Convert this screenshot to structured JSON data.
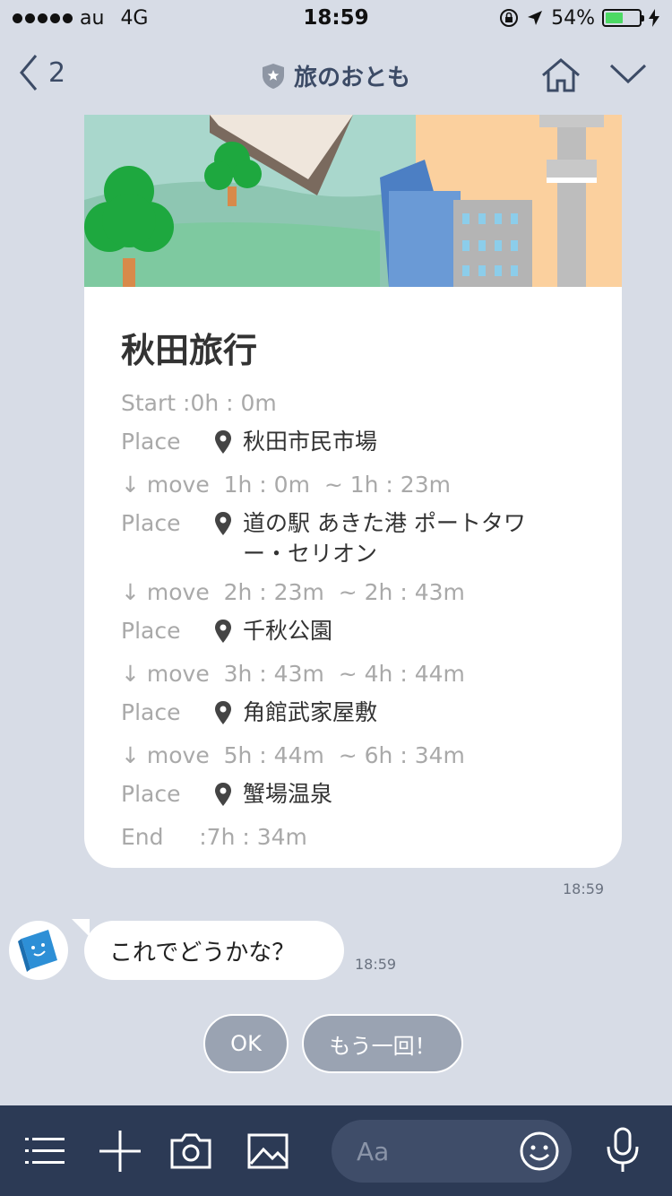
{
  "status_bar": {
    "carrier": "au",
    "network": "4G",
    "time": "18:59",
    "battery": "54%",
    "battery_level": 0.54
  },
  "nav": {
    "back_count": "2",
    "title": "旅のおとも"
  },
  "card": {
    "title": "秋田旅行",
    "start": {
      "label": "Start",
      "value": " :0h : 0m"
    },
    "end": {
      "label": "End",
      "value": "     :7h : 34m"
    },
    "place_label": "Place",
    "move_label": "↓ move",
    "places": [
      "秋田市民市場",
      "道の駅 あきた港 ポートタワー・セリオン",
      "千秋公園",
      "角館武家屋敷",
      "蟹場温泉"
    ],
    "moves": [
      "  1h : 0m  ~ 1h : 23m",
      "  2h : 23m  ~ 2h : 43m",
      "  3h : 43m  ~ 4h : 44m",
      "  5h : 44m  ~ 6h : 34m"
    ],
    "timestamp": "18:59"
  },
  "bot_message": {
    "text": "これでどうかな？",
    "timestamp": "18:59"
  },
  "quick_replies": [
    "OK",
    "もう一回！"
  ],
  "toolbar": {
    "input_placeholder": "Aa"
  },
  "colors": {
    "background": "#d7dce6",
    "toolbar": "#2c3a55",
    "nav_accent": "#3c4b66",
    "battery": "#4cd964",
    "quick_reply": "#9aa3b2"
  }
}
